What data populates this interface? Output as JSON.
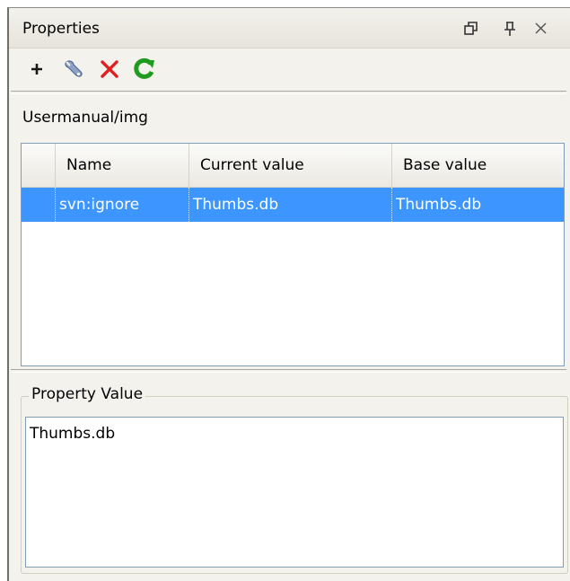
{
  "panel": {
    "title": "Properties",
    "controls": [
      "restore-icon",
      "pin-icon",
      "close-icon"
    ],
    "close_glyph": "✕"
  },
  "toolbar": {
    "items": [
      {
        "name": "add",
        "icon": "plus-icon",
        "color": "#1a1a1a"
      },
      {
        "name": "edit",
        "icon": "wrench-icon",
        "color": "#6f86b0"
      },
      {
        "name": "remove",
        "icon": "x-icon",
        "color": "#e02020"
      },
      {
        "name": "refresh",
        "icon": "refresh-icon",
        "color": "#1f9b1f"
      }
    ]
  },
  "path": "Usermanual/img",
  "table": {
    "columns": [
      "Name",
      "Current value",
      "Base value"
    ],
    "rows": [
      {
        "name": "svn:ignore",
        "current": "Thumbs.db",
        "base": "Thumbs.db",
        "selected": true
      }
    ],
    "selection_color": "#3d95ff"
  },
  "property_value": {
    "label": "Property Value",
    "text": "Thumbs.db"
  }
}
